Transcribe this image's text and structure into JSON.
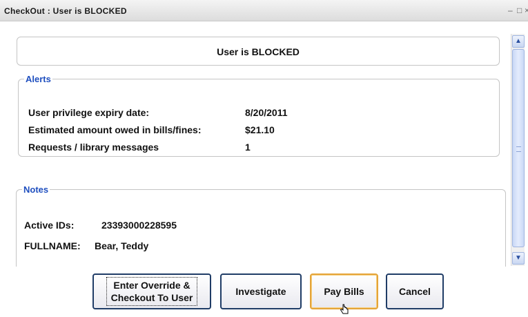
{
  "window": {
    "title": "CheckOut : User is BLOCKED",
    "controls": {
      "minimize": "–",
      "maximize": "□",
      "close": "×"
    }
  },
  "header": {
    "status": "User is BLOCKED"
  },
  "alerts": {
    "legend": "Alerts",
    "rows": [
      {
        "label": "User privilege expiry date:",
        "value": "8/20/2011"
      },
      {
        "label": "Estimated amount owed in bills/fines:",
        "value": "$21.10"
      },
      {
        "label": "Requests / library messages",
        "value": "1"
      }
    ]
  },
  "notes": {
    "legend": "Notes",
    "rows": [
      {
        "label": "Active IDs:",
        "value": "23393000228595"
      },
      {
        "label": "FULLNAME:",
        "value": "Bear, Teddy"
      }
    ]
  },
  "scrollbar": {
    "up_icon": "▲",
    "down_icon": "▼"
  },
  "buttons": {
    "override_line1": "Enter Override &",
    "override_line2": "Checkout To User",
    "investigate": "Investigate",
    "pay_bills": "Pay Bills",
    "cancel": "Cancel"
  },
  "icons": {
    "cursor": "hand-pointer-icon"
  },
  "colors": {
    "legend_blue": "#1f4fbf",
    "button_border": "#1f3c66",
    "default_button_border": "#e4a43a",
    "scroll_blue": "#c9d8f6"
  }
}
